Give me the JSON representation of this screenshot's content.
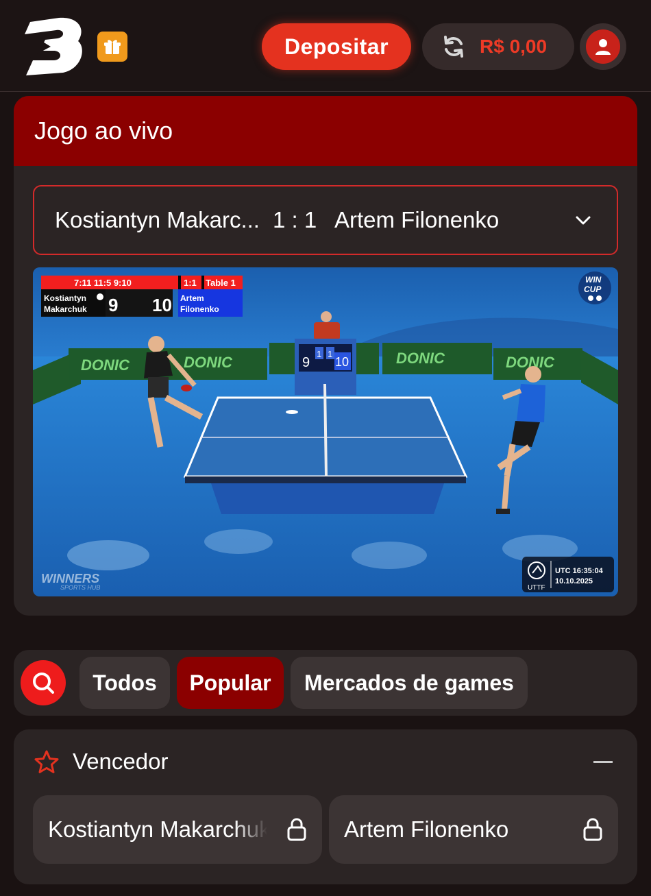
{
  "header": {
    "deposit_label": "Depositar",
    "balance": "R$ 0,00",
    "icons": [
      "brand-logo",
      "gift-icon",
      "refresh-icon",
      "user-icon"
    ]
  },
  "live": {
    "title": "Jogo ao vivo",
    "match": {
      "player1": "Kostiantyn Makarc...",
      "score": "1 : 1",
      "player2": "Artem Filonenko"
    },
    "video": {
      "sets": "7:11 11:5 9:10",
      "set_score": "1:1",
      "table": "Table 1",
      "p1_first": "Kostiantyn",
      "p1_last": "Makarchuk",
      "p1_points": "9",
      "p2_first": "Artem",
      "p2_last": "Filonenko",
      "p2_points": "10",
      "board_left": "9",
      "board_mid1": "1",
      "board_mid2": "1",
      "board_right": "10",
      "sponsor": "DONIC",
      "cup_line1": "WIN",
      "cup_line2": "CUP",
      "watermark1": "WINNERS",
      "watermark2": "SPORTS HUB",
      "utc_time": "UTC 16:35:04",
      "utc_date": "10.10.2025",
      "uttf": "UTTF"
    }
  },
  "filters": {
    "items": [
      {
        "label": "Todos",
        "active": false
      },
      {
        "label": "Popular",
        "active": true
      },
      {
        "label": "Mercados de games",
        "active": false
      }
    ]
  },
  "market": {
    "title": "Vencedor",
    "options": [
      {
        "label": "Kostiantyn Makarchuk",
        "locked": true
      },
      {
        "label": "Artem Filonenko",
        "locked": true
      }
    ]
  },
  "colors": {
    "accent": "#e4321f",
    "header_red": "#8b0000",
    "card_bg": "#2b2424",
    "page_bg": "#1a1212"
  }
}
